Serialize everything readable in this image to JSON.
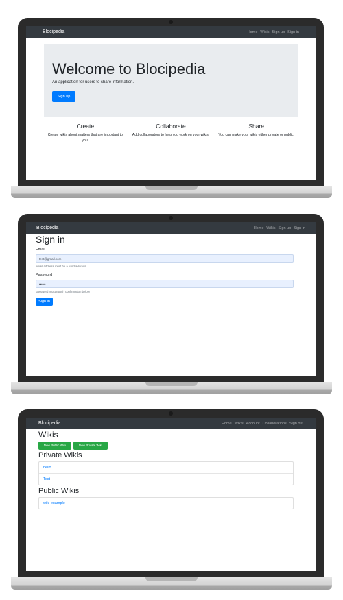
{
  "screen1": {
    "nav": {
      "brand": "Blocipedia",
      "links": [
        "Home",
        "Wikis",
        "Sign up",
        "Sign in"
      ]
    },
    "hero": {
      "title": "Welcome to Blocipedia",
      "subtitle": "An application for users to share information.",
      "signup_label": "Sign up"
    },
    "features": [
      {
        "title": "Create",
        "text": "Create wikis about matters that are important to you."
      },
      {
        "title": "Collaborate",
        "text": "Add collaborators to help you work on your wikis."
      },
      {
        "title": "Share",
        "text": "You can make your wikis either private or public."
      }
    ]
  },
  "screen2": {
    "nav": {
      "brand": "Blocipedia",
      "links": [
        "Home",
        "Wikis",
        "Sign up",
        "Sign in"
      ]
    },
    "title": "Sign in",
    "email_label": "Email",
    "email_value": "test@gmail.com",
    "email_help": "email address must be a valid address",
    "password_label": "Password",
    "password_value": "••••••",
    "password_help": "password must match confirmation below",
    "submit_label": "Sign in"
  },
  "screen3": {
    "nav": {
      "brand": "Blocipedia",
      "links": [
        "Home",
        "Wikis",
        "Account",
        "Collaborations",
        "Sign out"
      ]
    },
    "title": "Wikis",
    "new_public_label": "New Public Wiki",
    "new_private_label": "New Private Wiki",
    "private_heading": "Private Wikis",
    "private_wikis": [
      "hello",
      "Test"
    ],
    "public_heading": "Public Wikis",
    "public_wikis": [
      "wiki-example"
    ]
  },
  "colors": {
    "navbar": "#343a40",
    "primary": "#007bff",
    "success": "#28a745",
    "jumbotron": "#e9ecef",
    "laptop_bezel": "#2b2b2b",
    "laptop_base": "#d3d3d3"
  }
}
